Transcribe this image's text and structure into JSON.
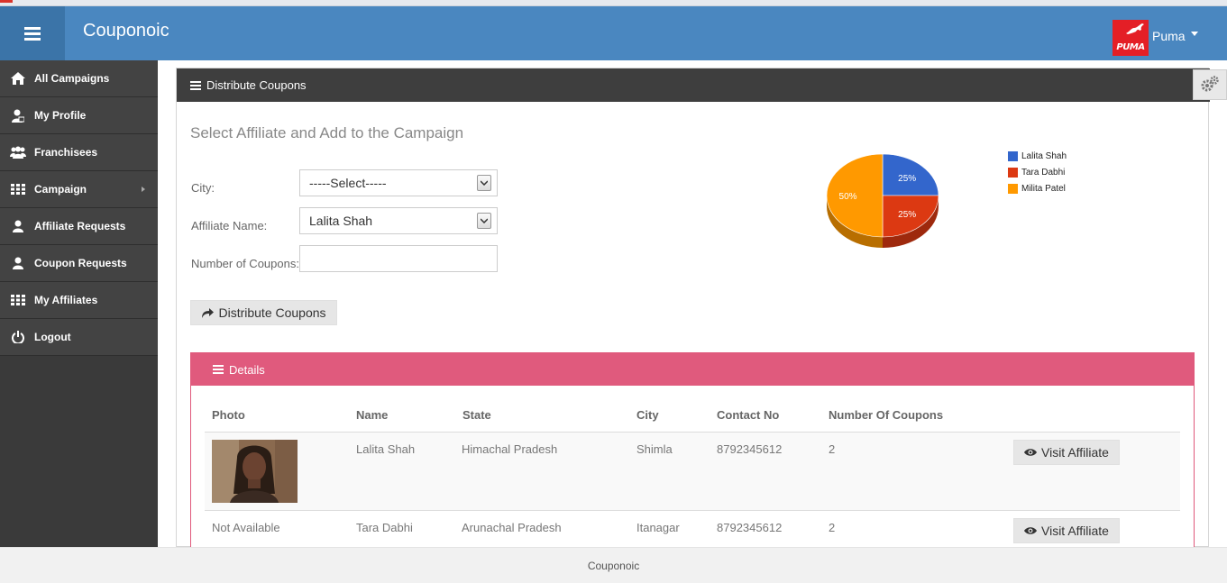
{
  "app": {
    "brand": "Couponoic",
    "user_name": "Puma",
    "user_logo_text": "PUMA"
  },
  "colors": {
    "navbar": "#4a87c0",
    "sidebar": "#434343",
    "panel_head": "#3e3e3e",
    "details_head": "#e05a7d"
  },
  "sidebar": {
    "items": [
      {
        "label": "All Campaigns",
        "icon": "home-icon"
      },
      {
        "label": "My Profile",
        "icon": "user-profile-icon"
      },
      {
        "label": "Franchisees",
        "icon": "users-group-icon"
      },
      {
        "label": "Campaign",
        "icon": "grid-icon",
        "has_submenu": true
      },
      {
        "label": "Affiliate Requests",
        "icon": "user-icon"
      },
      {
        "label": "Coupon Requests",
        "icon": "user-icon"
      },
      {
        "label": "My Affiliates",
        "icon": "grid-icon"
      },
      {
        "label": "Logout",
        "icon": "power-icon"
      }
    ]
  },
  "panel": {
    "title": "Distribute Coupons",
    "subtitle": "Select Affiliate and Add to the Campaign",
    "city_label": "City:",
    "city_value": "-----Select-----",
    "affiliate_label": "Affiliate Name:",
    "affiliate_value": "Lalita Shah",
    "coupons_label": "Number of Coupons:",
    "coupons_value": "",
    "distribute_button": "Distribute Coupons"
  },
  "chart_data": {
    "type": "pie",
    "slices": [
      {
        "label": "Lalita Shah",
        "value": 25,
        "color": "#3366cc"
      },
      {
        "label": "Tara Dabhi",
        "value": 25,
        "color": "#dc3912"
      },
      {
        "label": "Milita Patel",
        "value": 50,
        "color": "#ff9900"
      }
    ],
    "value_labels": [
      "25%",
      "25%",
      "50%"
    ],
    "legend_position": "right",
    "three_d": true
  },
  "details": {
    "title": "Details",
    "columns": [
      "Photo",
      "Name",
      "State",
      "City",
      "Contact No",
      "Number Of Coupons"
    ],
    "rows": [
      {
        "photo": "",
        "name": "Lalita Shah",
        "state": "Himachal Pradesh",
        "city": "Shimla",
        "contact": "8792345612",
        "coupons": "2",
        "action": "Visit Affiliate"
      },
      {
        "photo": "Not Available",
        "name": "Tara Dabhi",
        "state": "Arunachal Pradesh",
        "city": "Itanagar",
        "contact": "8792345612",
        "coupons": "2",
        "action": "Visit Affiliate"
      }
    ]
  },
  "footer": {
    "text": "Couponoic"
  }
}
